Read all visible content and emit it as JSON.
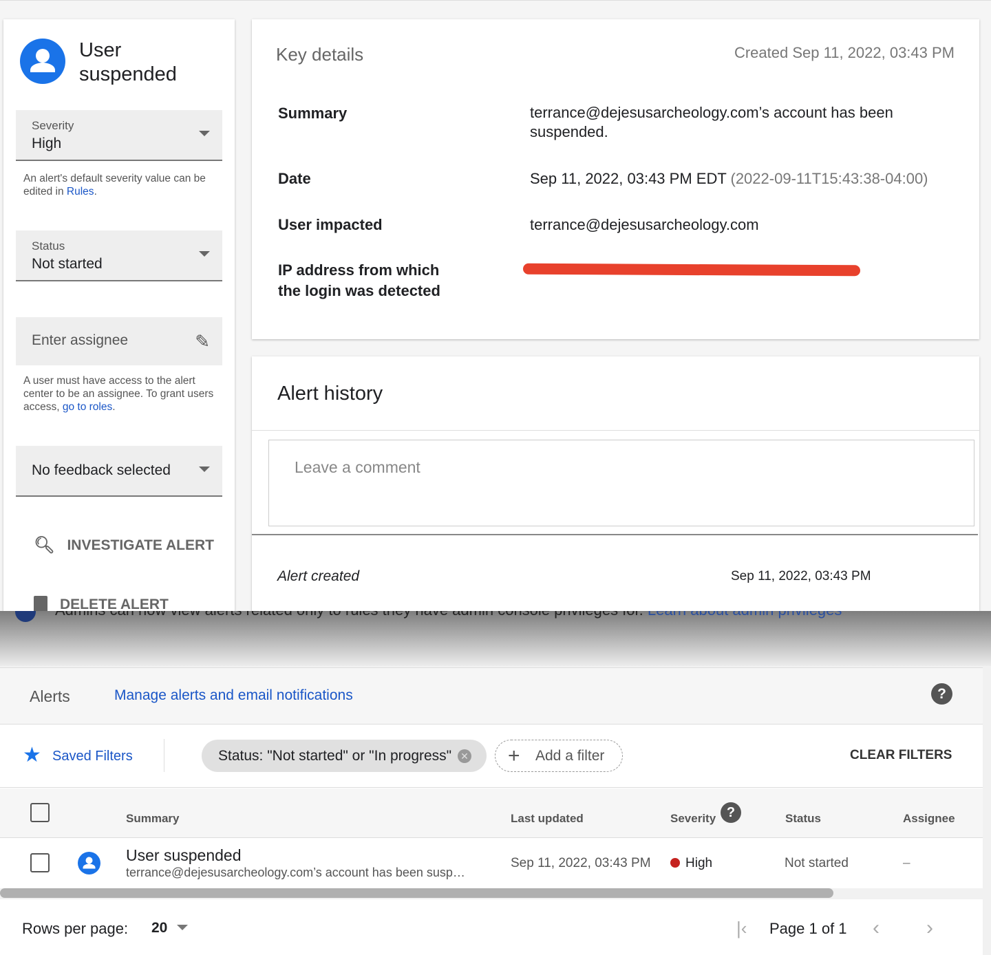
{
  "detail": {
    "title": "User suspended",
    "severity": {
      "label": "Severity",
      "value": "High"
    },
    "severity_help": "An alert's default severity value can be edited in ",
    "rules_link": "Rules",
    "status": {
      "label": "Status",
      "value": "Not started"
    },
    "assignee_placeholder": "Enter assignee",
    "assignee_help": "A user must have access to the alert center to be an assignee. To grant users access, ",
    "roles_link": "go to roles",
    "feedback": "No feedback selected",
    "investigate": "INVESTIGATE ALERT",
    "delete": "DELETE ALERT"
  },
  "key_details": {
    "title": "Key details",
    "created": "Created Sep 11, 2022, 03:43 PM",
    "rows": [
      {
        "label": "Summary",
        "value": "terrance@dejesusarcheology.com’s account has been suspended."
      },
      {
        "label": "Date",
        "value": "Sep 11, 2022, 03:43 PM EDT",
        "extra": "(2022-09-11T15:43:38-04:00)"
      },
      {
        "label": "User impacted",
        "value": "terrance@dejesusarcheology.com"
      },
      {
        "label": "IP address from which the login was detected",
        "value": ""
      }
    ]
  },
  "history": {
    "title": "Alert history",
    "comment_placeholder": "Leave a comment",
    "event": "Alert created",
    "event_time": "Sep 11, 2022, 03:43 PM"
  },
  "banner": {
    "text": "Admins can now view alerts related only to rules they have admin console privileges for. ",
    "link": "Learn about admin privileges"
  },
  "alerts": {
    "title": "Alerts",
    "manage_link": "Manage alerts and email notifications",
    "saved_filters": "Saved Filters",
    "filter_chip": "Status: \"Not started\" or \"In progress\"",
    "add_filter": "Add a filter",
    "clear": "CLEAR FILTERS",
    "columns": [
      "Summary",
      "Last updated",
      "Severity",
      "Status",
      "Assignee"
    ],
    "rows": [
      {
        "title": "User suspended",
        "summary": "terrance@dejesusarcheology.com’s account has been susp…",
        "updated": "Sep 11, 2022, 03:43 PM",
        "severity": "High",
        "status": "Not started",
        "assignee": "–"
      }
    ],
    "rows_per_page_label": "Rows per page:",
    "rows_per_page": "20",
    "page": "Page 1 of 1"
  },
  "colors": {
    "accent": "#1a73e8",
    "high": "#c5221f",
    "redaction": "#e8412c"
  }
}
